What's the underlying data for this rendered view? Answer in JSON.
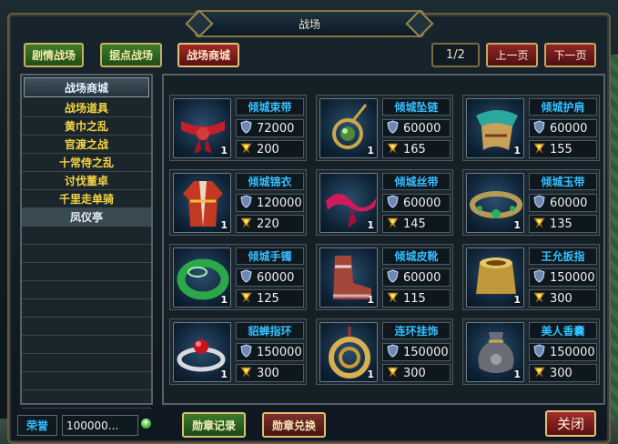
{
  "window": {
    "title": "战场"
  },
  "tabs": [
    {
      "label": "剧情战场"
    },
    {
      "label": "据点战场"
    },
    {
      "label": "战场商城"
    }
  ],
  "pager": {
    "text": "1/2",
    "prev": "上一页",
    "next": "下一页"
  },
  "sidebar": {
    "header": "战场商城",
    "items": [
      {
        "label": "战场道具"
      },
      {
        "label": "黄巾之乱"
      },
      {
        "label": "官渡之战"
      },
      {
        "label": "十常侍之乱"
      },
      {
        "label": "讨伐董卓"
      },
      {
        "label": "千里走单骑"
      },
      {
        "label": "凤仪亭"
      }
    ]
  },
  "items": [
    {
      "name": "倾城束带",
      "honor": "72000",
      "medal": "200",
      "qty": "1",
      "icon": "sash-icon"
    },
    {
      "name": "倾城坠链",
      "honor": "60000",
      "medal": "165",
      "qty": "1",
      "icon": "pendant-icon"
    },
    {
      "name": "倾城护肩",
      "honor": "60000",
      "medal": "155",
      "qty": "1",
      "icon": "shoulder-guard-icon"
    },
    {
      "name": "倾城锦衣",
      "honor": "120000",
      "medal": "220",
      "qty": "1",
      "icon": "robe-icon"
    },
    {
      "name": "倾城丝带",
      "honor": "60000",
      "medal": "145",
      "qty": "1",
      "icon": "ribbon-icon"
    },
    {
      "name": "倾城玉带",
      "honor": "60000",
      "medal": "135",
      "qty": "1",
      "icon": "jade-belt-icon"
    },
    {
      "name": "倾城手镯",
      "honor": "60000",
      "medal": "125",
      "qty": "1",
      "icon": "bracelet-icon"
    },
    {
      "name": "倾城皮靴",
      "honor": "60000",
      "medal": "115",
      "qty": "1",
      "icon": "boots-icon"
    },
    {
      "name": "王允扳指",
      "honor": "150000",
      "medal": "300",
      "qty": "1",
      "icon": "thumb-ring-icon"
    },
    {
      "name": "貂蝉指环",
      "honor": "150000",
      "medal": "300",
      "qty": "1",
      "icon": "ring-icon"
    },
    {
      "name": "连环挂饰",
      "honor": "150000",
      "medal": "300",
      "qty": "1",
      "icon": "chain-ornament-icon"
    },
    {
      "name": "美人香囊",
      "honor": "150000",
      "medal": "300",
      "qty": "1",
      "icon": "sachet-icon"
    }
  ],
  "footer": {
    "honor_label": "荣誉",
    "honor_value": "100000...",
    "medal_record": "勋章记录",
    "medal_exchange": "勋章兑换",
    "close": "关闭"
  },
  "colors": {
    "item_name": "#33c0ff",
    "category_text": "#f5d542",
    "tab_active": "#a32a2a",
    "tab_inactive": "#3c7d2c"
  }
}
